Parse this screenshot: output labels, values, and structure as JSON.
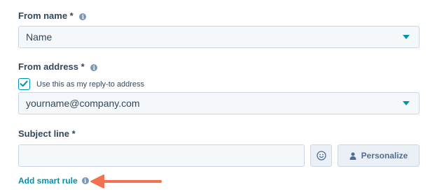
{
  "from_name": {
    "label": "From name *",
    "info_icon": "info-icon",
    "selected_value": "Name"
  },
  "from_address": {
    "label": "From address *",
    "info_icon": "info-icon",
    "reply_to_checkbox": {
      "label": "Use this as my reply-to address",
      "checked": true
    },
    "selected_value": "yourname@company.com"
  },
  "subject_line": {
    "label": "Subject line *",
    "value": "",
    "emoji_icon": "smiley-icon",
    "personalize_button": {
      "label": "Personalize",
      "icon": "person-icon"
    }
  },
  "smart_rule": {
    "link_label": "Add smart rule",
    "info_icon": "info-icon",
    "callout_arrow_color": "#f2724f"
  },
  "colors": {
    "accent": "#0091ae",
    "text": "#33475b",
    "input_bg": "#f5f8fa",
    "border": "#cbd6e2"
  }
}
